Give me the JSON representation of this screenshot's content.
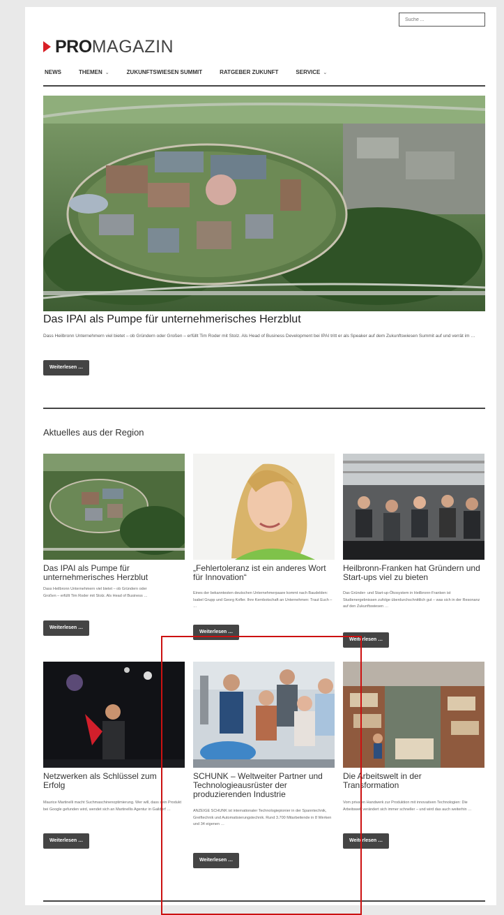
{
  "search": {
    "placeholder": "Suche ..."
  },
  "logo": {
    "pro": "PRO",
    "magazin": "MAGAZIN"
  },
  "nav": [
    {
      "label": "NEWS",
      "has_dropdown": false
    },
    {
      "label": "THEMEN",
      "has_dropdown": true
    },
    {
      "label": "ZUKUNFTSWIESEN SUMMIT",
      "has_dropdown": false
    },
    {
      "label": "RATGEBER ZUKUNFT",
      "has_dropdown": false
    },
    {
      "label": "SERVICE",
      "has_dropdown": true
    }
  ],
  "hero": {
    "title": "Das IPAI als Pumpe für unternehmerisches Herzblut",
    "excerpt": "Dass Heilbronn Unternehmern viel bietet – ob Gründern oder Großen – erfüllt Tim Roder mit Stolz. Als Head of Business Development bei IPAI tritt er als Speaker auf dem Zukunftswiesen Summit auf und verrät im …",
    "button": "Weiterlesen …"
  },
  "section": {
    "title": "Aktuelles aus der Region"
  },
  "cards": [
    {
      "title": "Das IPAI als Pumpe für unternehmerisches Herzblut",
      "excerpt": "Dass Heilbronn Unternehmern viel bietet – ob Gründern oder Großen – erfüllt Tim Roder mit Stolz. Als Head of Business …",
      "button": "Weiterlesen …"
    },
    {
      "title": "„Fehlertoleranz ist ein anderes Wort für Innovation“",
      "excerpt": "Eines der bekanntesten deutschen Unternehmerpaare kommt nach Baudelden: Isabel Grupp und Georg Kofler. Ihre Kernbotschaft an Unternehmen: Traut Euch – …",
      "button": "Weiterlesen …"
    },
    {
      "title": "Heilbronn-Franken hat Gründern und Start-ups viel zu bieten",
      "excerpt": "Das Gründer- und Start-up-Ökosystem in Heilbronn-Franken ist Studienergebnissen zufolge überdurchschnittlich gut – was sich in der Resonanz auf den Zukunftswiesen …",
      "button": "Weiterlesen …"
    },
    {
      "title": "Netzwerken als Schlüssel zum Erfolg",
      "excerpt": "Maurice Martinelli macht Suchmaschinenoptimierung. Wer will, dass sein Produkt bei Google gefunden wird, wendet sich an Martinellis Agentur in Gaildorf …",
      "button": "Weiterlesen …"
    },
    {
      "title": "SCHUNK – Weltweiter Partner und Technologieausrüster der produzierenden Industrie",
      "excerpt": "ANZEIGE SCHUNK ist internationaler Technologiepionier in der Spanntechnik, Greiftechnik und Automatisierungstechnik. Rund 3.700 Mitarbeitende in 8 Werken und 34 eigenen …",
      "button": "Weiterlesen …"
    },
    {
      "title": "Die Arbeitswelt in der Transformation",
      "excerpt": "Vom privaten Handwerk zur Produktion mit innovativen Technologien: Die Arbeitswelt verändert sich immer schneller – und wird das auch weiterhin …",
      "button": "Weiterlesen …"
    }
  ],
  "colors": {
    "brand_red": "#d81f26",
    "button_bg": "#444444",
    "highlight_box": "#cc1111"
  }
}
